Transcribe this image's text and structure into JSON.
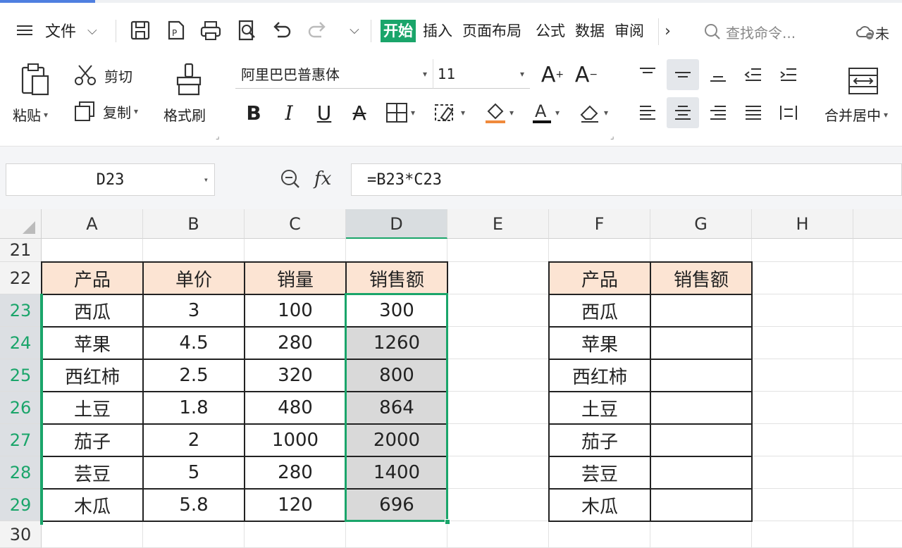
{
  "menubar": {
    "file_label": "文件",
    "tabs": [
      "开始",
      "插入",
      "页面布局",
      "公式",
      "数据",
      "审阅"
    ],
    "search_placeholder": "查找命令...",
    "cloud_label": "未"
  },
  "ribbon": {
    "paste": "粘贴",
    "cut": "剪切",
    "copy": "复制",
    "format_painter": "格式刷",
    "font_name": "阿里巴巴普惠体",
    "font_size": "11",
    "merge_center": "合并居中"
  },
  "formula_bar": {
    "name_box": "D23",
    "formula": "=B23*C23"
  },
  "grid": {
    "columns": [
      "A",
      "B",
      "C",
      "D",
      "E",
      "F",
      "G",
      "H"
    ],
    "selected_column": "D",
    "rows": [
      "21",
      "22",
      "23",
      "24",
      "25",
      "26",
      "27",
      "28",
      "29",
      "30"
    ],
    "table1": {
      "headers": [
        "产品",
        "单价",
        "销量",
        "销售额"
      ],
      "rows": [
        [
          "西瓜",
          "3",
          "100",
          "300"
        ],
        [
          "苹果",
          "4.5",
          "280",
          "1260"
        ],
        [
          "西红柿",
          "2.5",
          "320",
          "800"
        ],
        [
          "土豆",
          "1.8",
          "480",
          "864"
        ],
        [
          "茄子",
          "2",
          "1000",
          "2000"
        ],
        [
          "芸豆",
          "5",
          "280",
          "1400"
        ],
        [
          "木瓜",
          "5.8",
          "120",
          "696"
        ]
      ]
    },
    "table2": {
      "headers": [
        "产品",
        "销售额"
      ],
      "rows": [
        [
          "西瓜",
          ""
        ],
        [
          "苹果",
          ""
        ],
        [
          "西红柿",
          ""
        ],
        [
          "土豆",
          ""
        ],
        [
          "茄子",
          ""
        ],
        [
          "芸豆",
          ""
        ],
        [
          "木瓜",
          ""
        ]
      ]
    }
  },
  "colors": {
    "accent": "#1aa56a",
    "header_fill": "#fce4d3",
    "selection_fill": "#d9d9d9"
  }
}
